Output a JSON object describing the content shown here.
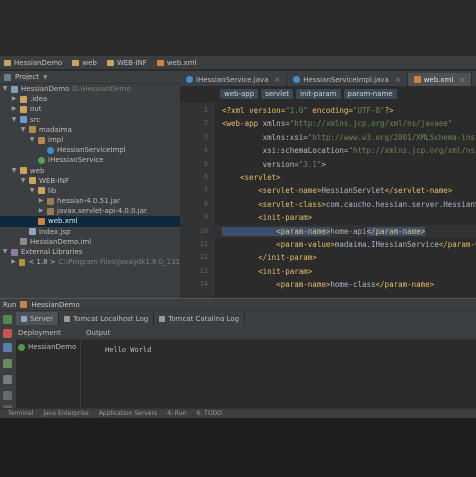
{
  "breadcrumb": [
    {
      "label": "HessianDemo",
      "icon": "folder-icon"
    },
    {
      "label": "web",
      "icon": "folder-icon"
    },
    {
      "label": "WEB-INF",
      "icon": "folder-icon"
    },
    {
      "label": "web.xml",
      "icon": "xml-file-icon"
    }
  ],
  "project": {
    "title": "Project",
    "tree": [
      {
        "label": "HessianDemo",
        "extra": "D:\\HessianDemo",
        "level": 0,
        "arrow": "open",
        "icon": "module-icon"
      },
      {
        "label": ".idea",
        "level": 1,
        "arrow": "closed",
        "icon": "folder-icon"
      },
      {
        "label": "out",
        "level": 1,
        "arrow": "closed",
        "icon": "folder-icon"
      },
      {
        "label": "src",
        "level": 1,
        "arrow": "open",
        "icon": "source-folder-icon"
      },
      {
        "label": "madaima",
        "level": 2,
        "arrow": "open",
        "icon": "package-icon"
      },
      {
        "label": "impl",
        "level": 3,
        "arrow": "open",
        "icon": "package-icon"
      },
      {
        "label": "HessianServiceImpl",
        "level": 4,
        "arrow": "none",
        "icon": "class-icon"
      },
      {
        "label": "IHessianService",
        "level": 3,
        "arrow": "none",
        "icon": "interface-icon"
      },
      {
        "label": "web",
        "level": 1,
        "arrow": "open",
        "icon": "folder-icon"
      },
      {
        "label": "WEB-INF",
        "level": 2,
        "arrow": "open",
        "icon": "folder-icon"
      },
      {
        "label": "lib",
        "level": 3,
        "arrow": "open",
        "icon": "folder-icon"
      },
      {
        "label": "hessian-4.0.51.jar",
        "level": 4,
        "arrow": "closed",
        "icon": "jar-icon"
      },
      {
        "label": "javax.servlet-api-4.0.0.jar",
        "level": 4,
        "arrow": "closed",
        "icon": "jar-icon"
      },
      {
        "label": "web.xml",
        "level": 3,
        "arrow": "none",
        "icon": "xml-file-icon",
        "selected": true
      },
      {
        "label": "index.jsp",
        "level": 2,
        "arrow": "none",
        "icon": "jsp-file-icon"
      },
      {
        "label": "HessianDemo.iml",
        "level": 1,
        "arrow": "none",
        "icon": "iml-file-icon"
      },
      {
        "label": "External Libraries",
        "level": 0,
        "arrow": "open",
        "icon": "library-icon"
      },
      {
        "label": "< 1.8 >",
        "extra": "C:\\Program Files\\Java\\jdk1.8.0_131",
        "level": 1,
        "arrow": "closed",
        "icon": "jdk-icon"
      }
    ]
  },
  "editor": {
    "tabs": [
      {
        "label": "IHessianService.java",
        "active": false
      },
      {
        "label": "HessianServiceImpl.java",
        "active": false
      },
      {
        "label": "web.xml",
        "active": true
      }
    ],
    "xml_breadcrumb": [
      "web-app",
      "servlet",
      "init-param",
      "param-name"
    ],
    "lines": [
      {
        "n": "1",
        "segs": [
          {
            "c": "tg",
            "t": "<?xml version="
          },
          {
            "c": "av",
            "t": "\"1.0\""
          },
          {
            "c": "tg",
            "t": " encoding="
          },
          {
            "c": "av",
            "t": "\"UTF-8\""
          },
          {
            "c": "tg",
            "t": "?>"
          }
        ]
      },
      {
        "n": "2",
        "segs": [
          {
            "c": "tg",
            "t": "<web-app"
          },
          {
            "c": "at",
            "t": " xmlns="
          },
          {
            "c": "av",
            "t": "\"http://xmlns.jcp.org/xml/ns/javaee\""
          }
        ]
      },
      {
        "n": "3",
        "segs": [
          {
            "c": "at",
            "t": "         xmlns:xsi="
          },
          {
            "c": "av",
            "t": "\"http://www.w3.org/2001/XMLSchema-instance\""
          }
        ]
      },
      {
        "n": "4",
        "segs": [
          {
            "c": "at",
            "t": "         xsi:schemaLocation="
          },
          {
            "c": "av",
            "t": "\"http://xmlns.jcp.org/xml/ns/javaee\""
          }
        ]
      },
      {
        "n": "5",
        "segs": [
          {
            "c": "at",
            "t": "         version="
          },
          {
            "c": "av",
            "t": "\"3.1\""
          },
          {
            "c": "tg",
            "t": ">"
          }
        ]
      },
      {
        "n": "6",
        "segs": [
          {
            "c": "tg",
            "t": "    <servlet>"
          }
        ]
      },
      {
        "n": "7",
        "segs": [
          {
            "c": "tg",
            "t": "        <servlet-name>"
          },
          {
            "c": "tx",
            "t": "HessianServlet"
          },
          {
            "c": "tg",
            "t": "</servlet-name>"
          }
        ]
      },
      {
        "n": "8",
        "segs": [
          {
            "c": "tg",
            "t": "        <servlet-class>"
          },
          {
            "c": "tx",
            "t": "com.caucho.hessian.server.HessianServlet"
          },
          {
            "c": "tg",
            "t": "</servlet-class>"
          }
        ]
      },
      {
        "n": "9",
        "segs": [
          {
            "c": "tg",
            "t": "        <init-param>"
          }
        ]
      },
      {
        "n": "10",
        "hl": true,
        "segs": [
          {
            "c": "tg tagbox",
            "t": "            <param-name>"
          },
          {
            "c": "tx",
            "t": "home-api"
          },
          {
            "c": "tg tagbox",
            "t": "</param-name>"
          }
        ]
      },
      {
        "n": "11",
        "segs": [
          {
            "c": "tg",
            "t": "            <param-value>"
          },
          {
            "c": "tx",
            "t": "madaima.IHessianService"
          },
          {
            "c": "tg",
            "t": "</param-value>"
          }
        ]
      },
      {
        "n": "12",
        "segs": [
          {
            "c": "tg",
            "t": "        </init-param>"
          }
        ]
      },
      {
        "n": "13",
        "segs": [
          {
            "c": "tg",
            "t": "        <init-param>"
          }
        ]
      },
      {
        "n": "14",
        "segs": [
          {
            "c": "tg",
            "t": "            <param-name>"
          },
          {
            "c": "tx",
            "t": "home-class"
          },
          {
            "c": "tg",
            "t": "</param-name>"
          }
        ]
      }
    ]
  },
  "run": {
    "title": "Run",
    "config": "HessianDemo",
    "tabs": [
      {
        "label": "Server",
        "active": true
      },
      {
        "label": "Tomcat Localhost Log",
        "active": false
      },
      {
        "label": "Tomcat Catalina Log",
        "active": false
      }
    ],
    "col_deployment": "Deployment",
    "col_output": "Output",
    "deployment_item": "HessianDemo",
    "output_text": "Hello World"
  },
  "bottom_tabs": [
    "Terminal",
    "Java Enterprise",
    "Application Servers",
    "4: Run",
    "6: TODO"
  ],
  "colors": {
    "accent": "#0d293e",
    "tag": "#e8bf6a",
    "string": "#6a8759",
    "text": "#a9b7c6"
  }
}
